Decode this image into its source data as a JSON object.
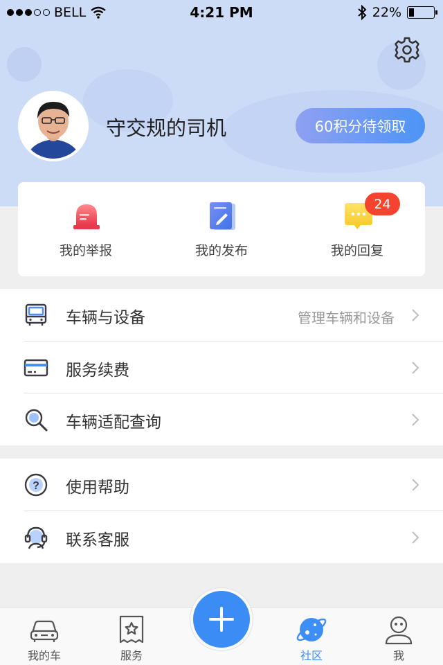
{
  "status": {
    "carrier": "BELL",
    "time": "4:21 PM",
    "battery": "22%",
    "battery_level": 0.22
  },
  "profile": {
    "name": "守交规的司机",
    "points_button": "60积分待领取"
  },
  "quick_actions": [
    {
      "label": "我的举报"
    },
    {
      "label": "我的发布"
    },
    {
      "label": "我的回复",
      "badge": "24"
    }
  ],
  "menu_group_1": [
    {
      "label": "车辆与设备",
      "hint": "管理车辆和设备"
    },
    {
      "label": "服务续费"
    },
    {
      "label": "车辆适配查询"
    }
  ],
  "menu_group_2": [
    {
      "label": "使用帮助"
    },
    {
      "label": "联系客服"
    }
  ],
  "tabbar": [
    {
      "label": "我的车",
      "active": false
    },
    {
      "label": "服务",
      "active": false
    },
    {
      "label": "社区",
      "active": true
    },
    {
      "label": "我",
      "active": false
    }
  ],
  "colors": {
    "accent": "#3b8df5",
    "badge": "#f4432f",
    "hero_bg": "#ccdcf7"
  }
}
